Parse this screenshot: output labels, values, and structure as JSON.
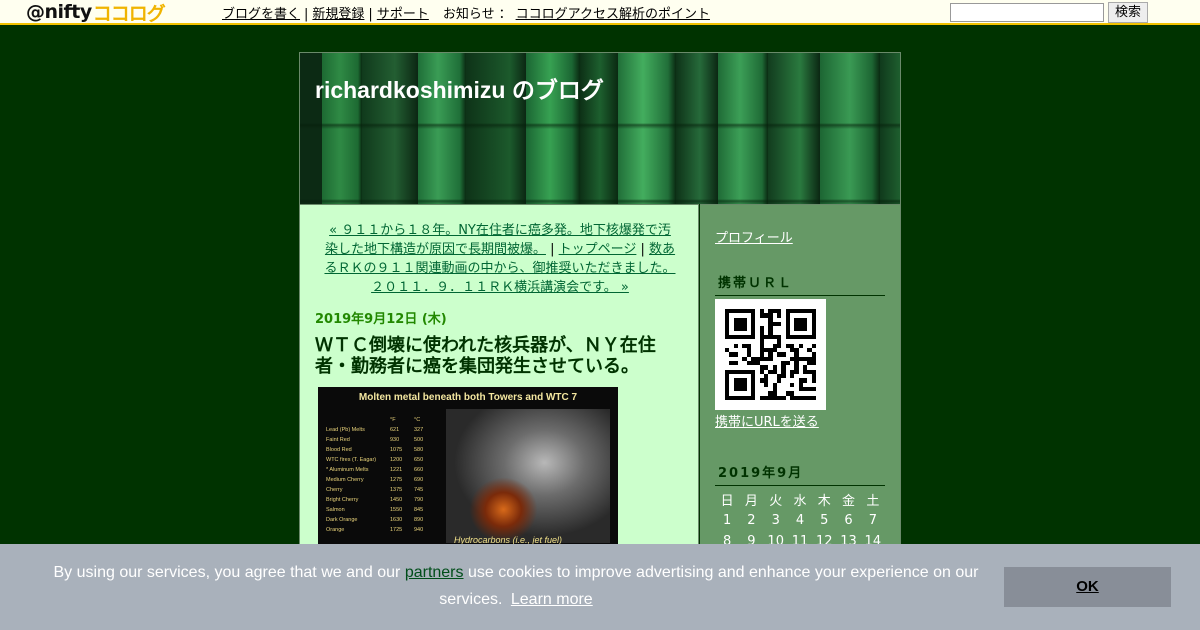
{
  "topbar": {
    "logo_nifty": "@nifty",
    "logo_cocolog": "ココログ",
    "nav": [
      "ブログを書く",
      "新規登録",
      "サポート"
    ],
    "news_label": "お知らせ",
    "news_link": "ココログアクセス解析のポイント",
    "search_value": "",
    "search_button": "検索",
    "accent_color": "#f2c200"
  },
  "blog": {
    "title": "richardkoshimizu のブログ"
  },
  "main": {
    "prev_link": "« ９１１から１８年。NY在住者に癌多発。地下核爆発で汚染した地下構造が原因で長期間被爆。",
    "top_link": "トップページ",
    "next_link": "数あるＲＫの９１１関連動画の中から、御推奨いただきました。２０１１．９．１１ＲＫ横浜講演会です。 »",
    "separator": "|",
    "post_date": "2019年9月12日 (木)",
    "post_title": "ＷＴＣ倒壊に使われた核兵器が、ＮＹ在住者・勤務者に癌を集団発生させている。",
    "image": {
      "heading": "Molten metal beneath both Towers and WTC 7",
      "col_f": "°F",
      "col_c": "°C",
      "rows": [
        [
          "Lead (Pb) Melts",
          "621",
          "327"
        ],
        [
          "Faint Red",
          "930",
          "500"
        ],
        [
          "Blood Red",
          "1075",
          "580"
        ],
        [
          "WTC fires (T. Eagar)",
          "1200",
          "650"
        ],
        [
          "* Aluminum Melts",
          "1221",
          "660"
        ],
        [
          "Medium Cherry",
          "1275",
          "690"
        ],
        [
          "Cherry",
          "1375",
          "745"
        ],
        [
          "Bright Cherry",
          "1450",
          "790"
        ],
        [
          "Salmon",
          "1550",
          "845"
        ],
        [
          "Dark Orange",
          "1630",
          "890"
        ],
        [
          "Orange",
          "1725",
          "940"
        ]
      ],
      "caption": "Hydrocarbons (i.e., jet fuel)"
    }
  },
  "sidebar": {
    "profile": "プロフィール",
    "mobile_url_heading": "携帯ＵＲＬ",
    "mobile_send": "携帯にURLを送る",
    "calendar_heading": "2019年9月",
    "weekdays": [
      "日",
      "月",
      "火",
      "水",
      "木",
      "金",
      "土"
    ],
    "weeks": [
      [
        "1",
        "2",
        "3",
        "4",
        "5",
        "6",
        "7"
      ],
      [
        "8",
        "9",
        "10",
        "11",
        "12",
        "13",
        "14"
      ]
    ]
  },
  "cookie": {
    "text_before": "By using our services, you agree that we and our ",
    "partners": "partners",
    "text_after": " use cookies to improve advertising and enhance your experience on our services.",
    "learn_more": "Learn more",
    "ok": "OK"
  },
  "colors": {
    "page_bg": "#003300",
    "main_bg": "#ccffcc",
    "sidebar_bg": "#669966",
    "date_color": "#228800",
    "cookie_bg": "#a9b1bb"
  }
}
